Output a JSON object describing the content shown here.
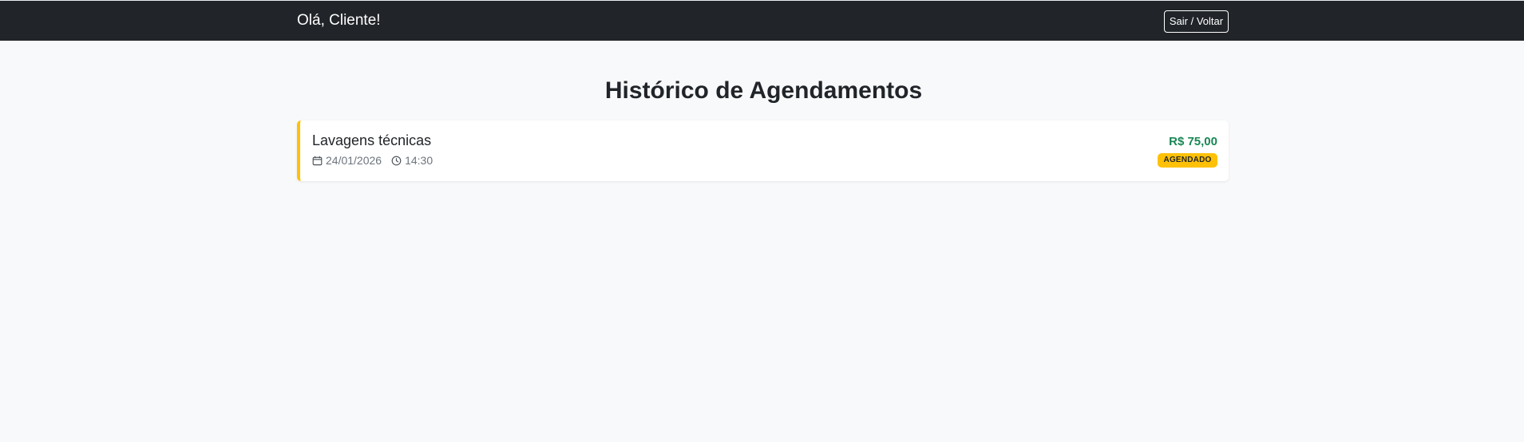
{
  "header": {
    "greeting": "Olá, Cliente!",
    "exit_button_label": "Sair / Voltar"
  },
  "main": {
    "title": "Histórico de Agendamentos",
    "appointments": [
      {
        "service": "Lavagens técnicas",
        "date": "24/01/2026",
        "time": "14:30",
        "price": "R$ 75,00",
        "status": "AGENDADO",
        "date_icon": "calendar-icon",
        "time_icon": "clock-icon"
      }
    ]
  },
  "colors": {
    "navbar_bg": "#212529",
    "page_bg": "#f8f9fa",
    "accent_warning": "#ffc107",
    "price_green": "#198754"
  }
}
